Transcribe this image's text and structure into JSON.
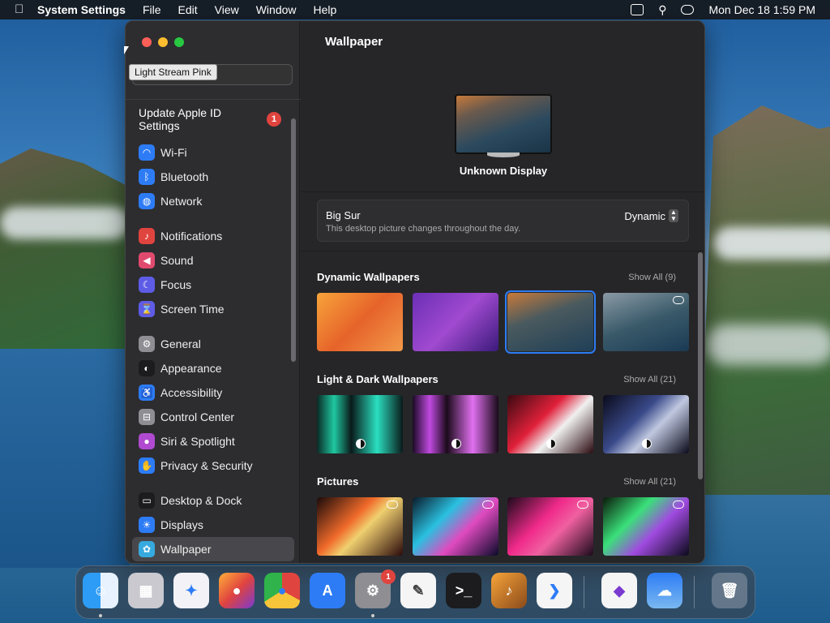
{
  "menubar": {
    "app": "System Settings",
    "menus": [
      "File",
      "Edit",
      "View",
      "Window",
      "Help"
    ],
    "clock": "Mon Dec 18  1:59 PM"
  },
  "tooltip": "Light Stream Pink",
  "sidebar": {
    "apple_id": {
      "label": "Update Apple ID Settings",
      "badge": "1"
    },
    "groups": [
      [
        {
          "label": "Wi-Fi",
          "icon": "wifi-icon",
          "color": "#2d7cf6"
        },
        {
          "label": "Bluetooth",
          "icon": "bluetooth-icon",
          "color": "#2d7cf6"
        },
        {
          "label": "Network",
          "icon": "globe-icon",
          "color": "#2d7cf6"
        }
      ],
      [
        {
          "label": "Notifications",
          "icon": "bell-icon",
          "color": "#e0443e"
        },
        {
          "label": "Sound",
          "icon": "speaker-icon",
          "color": "#e04a6e"
        },
        {
          "label": "Focus",
          "icon": "moon-icon",
          "color": "#5e5ce6"
        },
        {
          "label": "Screen Time",
          "icon": "hourglass-icon",
          "color": "#5e5ce6"
        }
      ],
      [
        {
          "label": "General",
          "icon": "gear-icon",
          "color": "#8e8e93"
        },
        {
          "label": "Appearance",
          "icon": "appearance-icon",
          "color": "#1c1c1e"
        },
        {
          "label": "Accessibility",
          "icon": "accessibility-icon",
          "color": "#2d7cf6"
        },
        {
          "label": "Control Center",
          "icon": "toggles-icon",
          "color": "#8e8e93"
        },
        {
          "label": "Siri & Spotlight",
          "icon": "siri-icon",
          "color": "#b04ad0"
        },
        {
          "label": "Privacy & Security",
          "icon": "hand-icon",
          "color": "#2d7cf6"
        }
      ],
      [
        {
          "label": "Desktop & Dock",
          "icon": "dock-icon",
          "color": "#1c1c1e"
        },
        {
          "label": "Displays",
          "icon": "sun-icon",
          "color": "#2d7cf6"
        },
        {
          "label": "Wallpaper",
          "icon": "flower-icon",
          "color": "#36aadf",
          "selected": true
        }
      ]
    ]
  },
  "main": {
    "title": "Wallpaper",
    "display_name": "Unknown Display",
    "current": {
      "name": "Big Sur",
      "desc": "This desktop picture changes throughout the day.",
      "mode": "Dynamic"
    },
    "sections": [
      {
        "title": "Dynamic Wallpapers",
        "show_all": "Show All (9)",
        "thumbs": [
          {
            "bg": "linear-gradient(135deg,#f7a43a,#e6632a 50%,#f29a4a)"
          },
          {
            "bg": "linear-gradient(135deg,#6b2fb5,#a04ad0 50%,#3a1a7a)"
          },
          {
            "bg": "linear-gradient(160deg,#c87a3a,#4a5a5e 40%,#1f3f57)",
            "selected": true
          },
          {
            "bg": "linear-gradient(160deg,#8a9aa5,#3a5a6a 50%,#1a3a55)",
            "cloud": true
          }
        ]
      },
      {
        "title": "Light & Dark Wallpapers",
        "show_all": "Show All (21)",
        "thumbs": [
          {
            "bg": "linear-gradient(90deg,#0a2a25,#1fc7a0 20%,#0a1a1a 40%,#2adfc0 70%,#0a1a1a)",
            "ld": true
          },
          {
            "bg": "linear-gradient(90deg,#1a0a25,#c04ae0 20%,#1a0a1a 40%,#e070f0 70%,#1a0a1a)",
            "ld": true
          },
          {
            "bg": "linear-gradient(135deg,#3a0a10,#e0203a 40%,#f0f0f0 60%,#2a0a10)",
            "ld": true
          },
          {
            "bg": "linear-gradient(135deg,#0a0a1a,#3a4a8a 40%,#c0c8e0 60%,#0a0a1a)",
            "ld": true
          }
        ]
      },
      {
        "title": "Pictures",
        "show_all": "Show All (21)",
        "thumbs": [
          {
            "bg": "linear-gradient(135deg,#1a0a0a,#f06a2a 40%,#f0d070 55%,#2a0a0a)",
            "cloud": true
          },
          {
            "bg": "linear-gradient(135deg,#0a1a2a,#2ac0e0 35%,#e04ac0 60%,#0a0a2a)",
            "cloud": true
          },
          {
            "bg": "linear-gradient(135deg,#1a0a1a,#f02a8a 40%,#f060a0 60%,#1a0a1a)",
            "cloud": true
          },
          {
            "bg": "linear-gradient(135deg,#0a1a0a,#3ae07a 35%,#a04ae0 60%,#0a0a1a)",
            "cloud": true
          }
        ]
      }
    ]
  },
  "dock": [
    {
      "name": "finder",
      "bg": "linear-gradient(90deg,#2d9cf6 50%,#e8f2ff 50%)",
      "glyph": "☺",
      "dot": true
    },
    {
      "name": "launchpad",
      "bg": "#c9c9cf",
      "glyph": "▦"
    },
    {
      "name": "safari",
      "bg": "#f2f2f7",
      "glyph": "✦",
      "fg": "#2d7cf6"
    },
    {
      "name": "firefox",
      "bg": "linear-gradient(135deg,#ffb03a,#e0443e 50%,#7a3ad0)",
      "glyph": "●"
    },
    {
      "name": "chrome",
      "bg": "conic-gradient(#e0443e 0 33%,#f7c53a 0 66%,#2fb34a 0)",
      "glyph": "●",
      "fg": "#2d7cf6"
    },
    {
      "name": "app-store",
      "bg": "#2d7cf6",
      "glyph": "A"
    },
    {
      "name": "system-settings",
      "bg": "#8e8e93",
      "glyph": "⚙",
      "badge": "1",
      "dot": true
    },
    {
      "name": "textedit",
      "bg": "#f5f5f5",
      "glyph": "✎",
      "fg": "#444"
    },
    {
      "name": "terminal",
      "bg": "#1c1c1e",
      "glyph": ">_"
    },
    {
      "name": "garageband",
      "bg": "linear-gradient(135deg,#f7a43a,#8a4a1a)",
      "glyph": "♪"
    },
    {
      "name": "vscode",
      "bg": "#f5f5f5",
      "glyph": "❯",
      "fg": "#2d7cf6"
    },
    {
      "name": "visual-studio",
      "bg": "#f5f5f5",
      "glyph": "◆",
      "fg": "#7a3ad0"
    },
    {
      "name": "weather",
      "bg": "linear-gradient(180deg,#2d7cf6,#7ab8f0)",
      "glyph": "☁"
    },
    {
      "name": "trash",
      "bg": "rgba(200,200,210,.35)",
      "glyph": "🗑"
    }
  ]
}
